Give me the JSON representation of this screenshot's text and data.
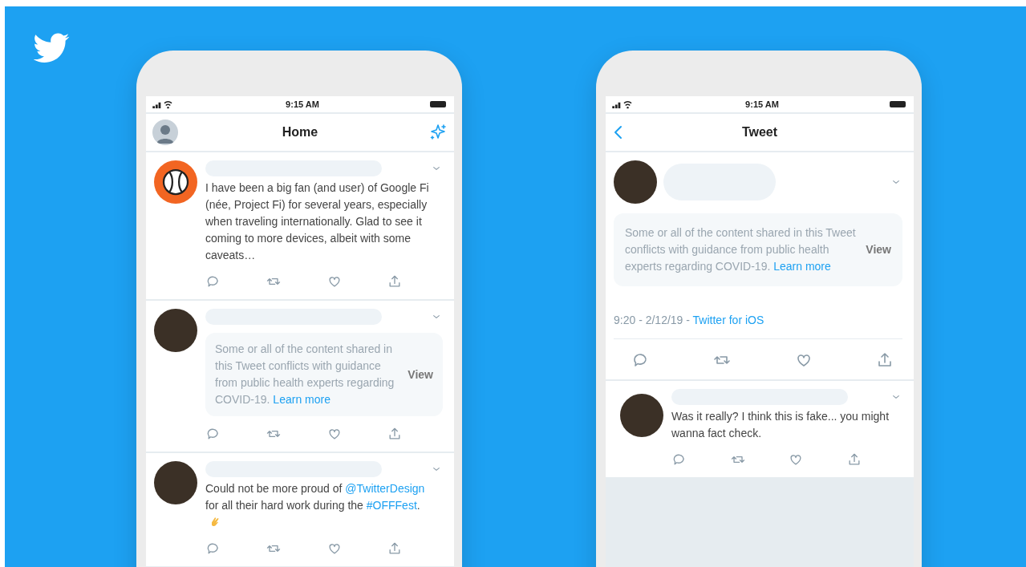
{
  "home_screen": {
    "status_time": "9:15 AM",
    "title": "Home",
    "tweets": [
      {
        "kind": "text",
        "avatar": {
          "kind": "badge"
        },
        "segments": [
          {
            "kind": "text",
            "text": "I have been a big fan (and user) of Google Fi (née, Project Fi) for several years, especially when traveling internationally. Glad to see it coming to more devices, albeit with some caveats…"
          }
        ]
      },
      {
        "kind": "notice",
        "avatar": {
          "kind": "photo"
        },
        "notice": {
          "text": "Some or all of the content shared in this Tweet conflicts with guidance from public health experts regarding COVID-19.",
          "link": "Learn more",
          "action": "View"
        }
      },
      {
        "kind": "text",
        "avatar": {
          "kind": "photo"
        },
        "segments": [
          {
            "kind": "text",
            "text": "Could not be more proud of "
          },
          {
            "kind": "link",
            "text": "@TwitterDesign"
          },
          {
            "kind": "text",
            "text": " for all their hard work during the "
          },
          {
            "kind": "link",
            "text": "#OFFFest"
          },
          {
            "kind": "text",
            "text": "."
          },
          {
            "kind": "emoji"
          }
        ]
      }
    ]
  },
  "tweet_screen": {
    "status_time": "9:15 AM",
    "title": "Tweet",
    "tweet": {
      "avatar": {
        "kind": "photo"
      },
      "notice": {
        "text": "Some or all of the content shared in this Tweet conflicts with guidance from public health experts regarding COVID-19.",
        "link": "Learn more",
        "action": "View"
      },
      "meta": "9:20 - 2/12/19 - ",
      "source": "Twitter for iOS"
    },
    "replies": [
      {
        "kind": "text",
        "avatar": {
          "kind": "photo"
        },
        "segments": [
          {
            "kind": "text",
            "text": "Was it really? I think this is fake... you might wanna fact check."
          }
        ]
      }
    ]
  }
}
